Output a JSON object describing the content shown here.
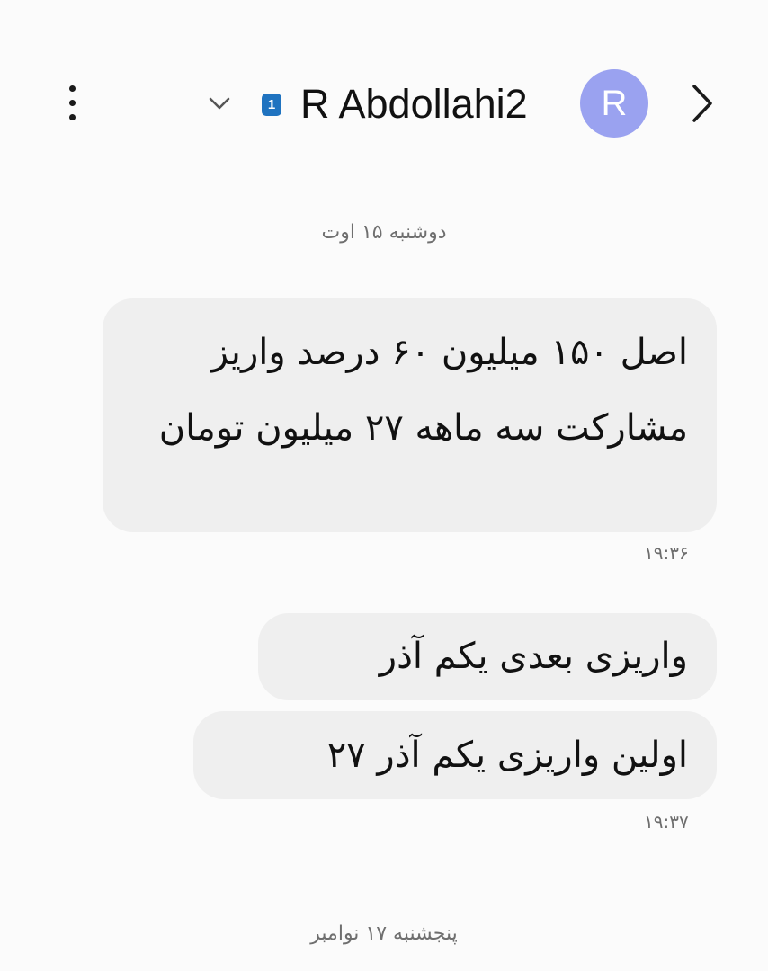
{
  "header": {
    "contact_name": "R Abdollahi2",
    "sim_label": "1",
    "avatar_initial": "R",
    "avatar_color": "#9aa2f0",
    "sim_badge_color": "#1f73c0",
    "icons": [
      "more-vertical-icon",
      "chevron-down-icon",
      "sim-card-icon",
      "chevron-right-icon"
    ]
  },
  "conversation": {
    "date_separators": [
      "دوشنبه ۱۵ اوت",
      "پنجشنبه ۱۷ نوامبر"
    ],
    "messages": [
      {
        "text": "اصل ۱۵۰ میلیون ۶۰ درصد واریز مشارکت سه ماهه ۲۷ میلیون تومان",
        "time": "۱۹:۳۶"
      },
      {
        "text": "واریزی بعدی یکم آذر",
        "time": ""
      },
      {
        "text": "اولین واریزی یکم آذر ۲۷",
        "time": "۱۹:۳۷"
      }
    ]
  }
}
